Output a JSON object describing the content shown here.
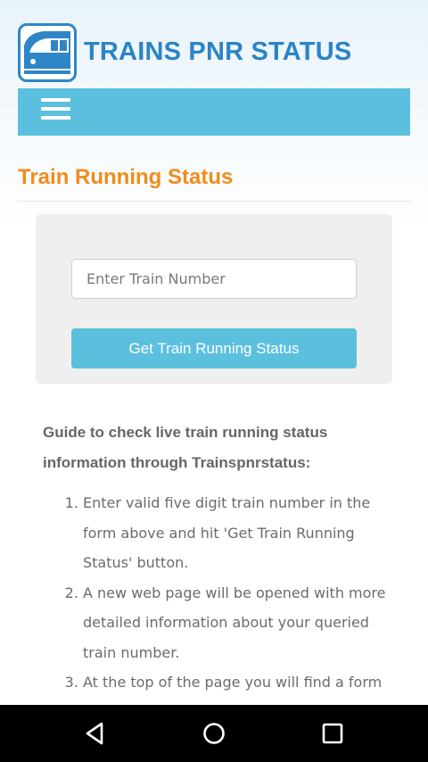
{
  "header": {
    "site_title": "TRAINS PNR STATUS",
    "logo_icon": "train-logo-icon",
    "brand_color": "#2b84c6"
  },
  "navbar": {
    "menu_icon": "hamburger-menu-icon",
    "color": "#5bc0de"
  },
  "page": {
    "title": "Train Running Status",
    "title_color": "#f08c1c"
  },
  "form": {
    "input_placeholder": "Enter Train Number",
    "input_value": "",
    "submit_label": "Get Train Running Status"
  },
  "guide": {
    "heading": "Guide to check live train running status information through Trainspnrstatus:",
    "steps": [
      "Enter valid five digit train number in the form above and hit 'Get Train Running Status' button.",
      "A new web page will be opened with more detailed information about your queried train number.",
      "At the top of the page you will find a form"
    ]
  },
  "system_nav": {
    "back_icon": "back-triangle-icon",
    "home_icon": "home-circle-icon",
    "recents_icon": "recents-square-icon"
  }
}
